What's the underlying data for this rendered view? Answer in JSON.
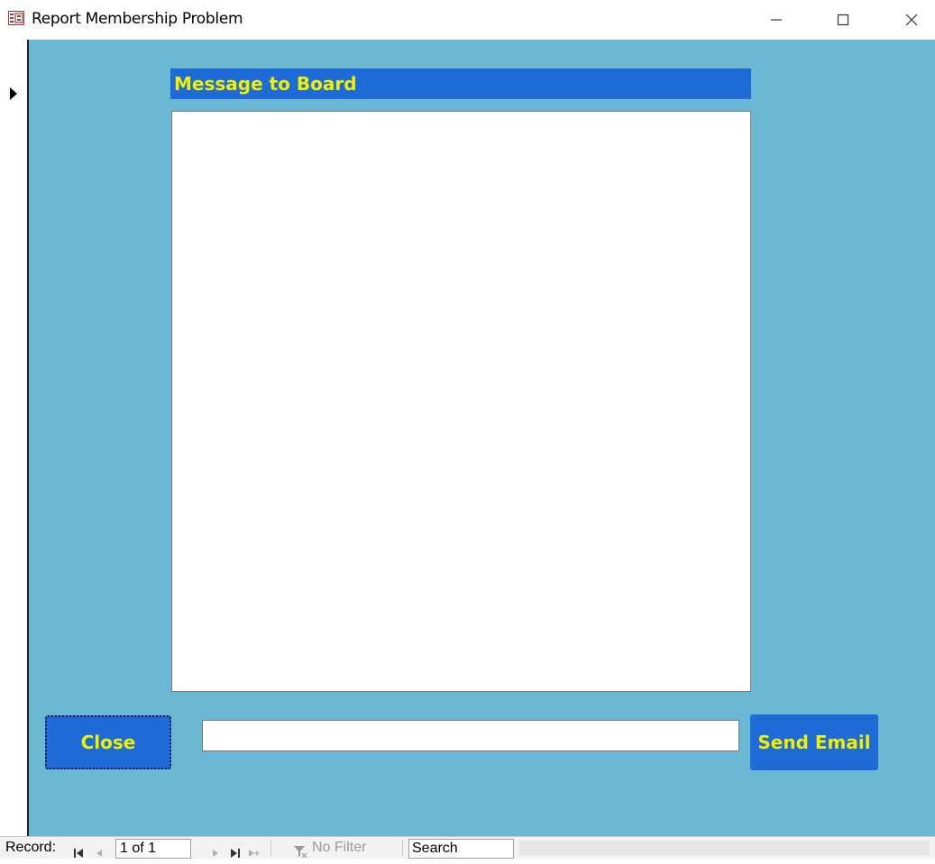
{
  "window": {
    "title": "Report Membership Problem",
    "icon": "form-icon",
    "controls": {
      "minimize": "minimize-icon",
      "maximize": "maximize-icon",
      "close": "close-icon"
    }
  },
  "form": {
    "background": "#6ab8d3",
    "accent": "#1e6ad6",
    "label_color": "#f0f000",
    "message_label": "Message to Board",
    "message_value": "",
    "subject_value": "",
    "close_button": "Close",
    "send_button": "Send Email"
  },
  "navigation": {
    "record_label": "Record:",
    "first_icon": "first-record-icon",
    "prev_icon": "prev-record-icon",
    "current": "1 of 1",
    "next_icon": "next-record-icon",
    "last_icon": "last-record-icon",
    "new_icon": "new-record-icon",
    "filter_icon": "filter-icon",
    "filter_text": "No Filter",
    "search_placeholder": "Search"
  }
}
